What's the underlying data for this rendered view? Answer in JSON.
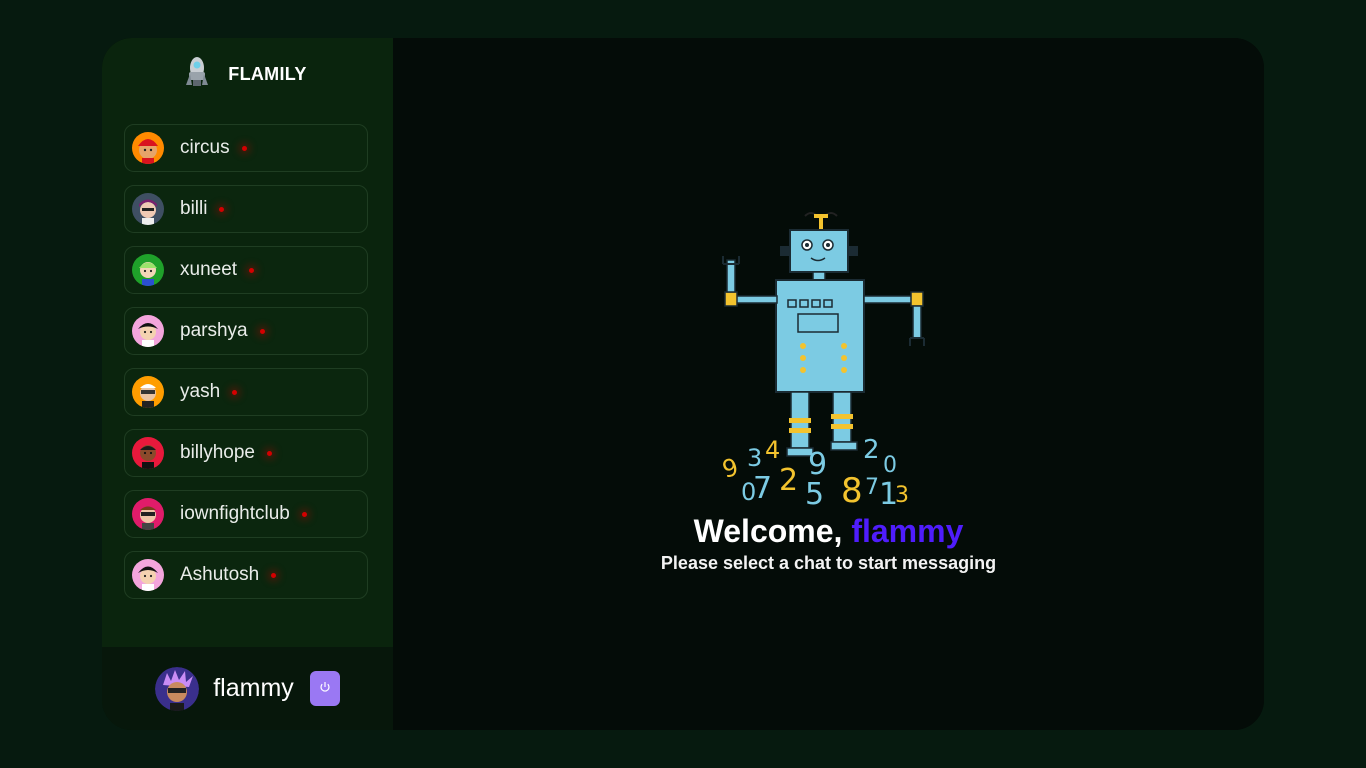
{
  "app": {
    "brand": "FLAMILY"
  },
  "contacts": [
    {
      "name": "circus"
    },
    {
      "name": "billi"
    },
    {
      "name": "xuneet"
    },
    {
      "name": "parshya"
    },
    {
      "name": "yash"
    },
    {
      "name": "billyhope"
    },
    {
      "name": "iownfightclub"
    },
    {
      "name": "Ashutosh"
    }
  ],
  "current_user": {
    "name": "flammy",
    "logout_icon": "power-icon"
  },
  "welcome": {
    "greeting": "Welcome,",
    "username": "flammy",
    "subtitle": "Please select a chat to start messaging"
  },
  "colors": {
    "page_bg": "#061a0f",
    "sidebar_bg": "#0a240d",
    "main_bg": "#040c08",
    "accent_purple": "#4f1dfc",
    "logout_button": "#9a78f3",
    "status_offline": "#d40000"
  }
}
